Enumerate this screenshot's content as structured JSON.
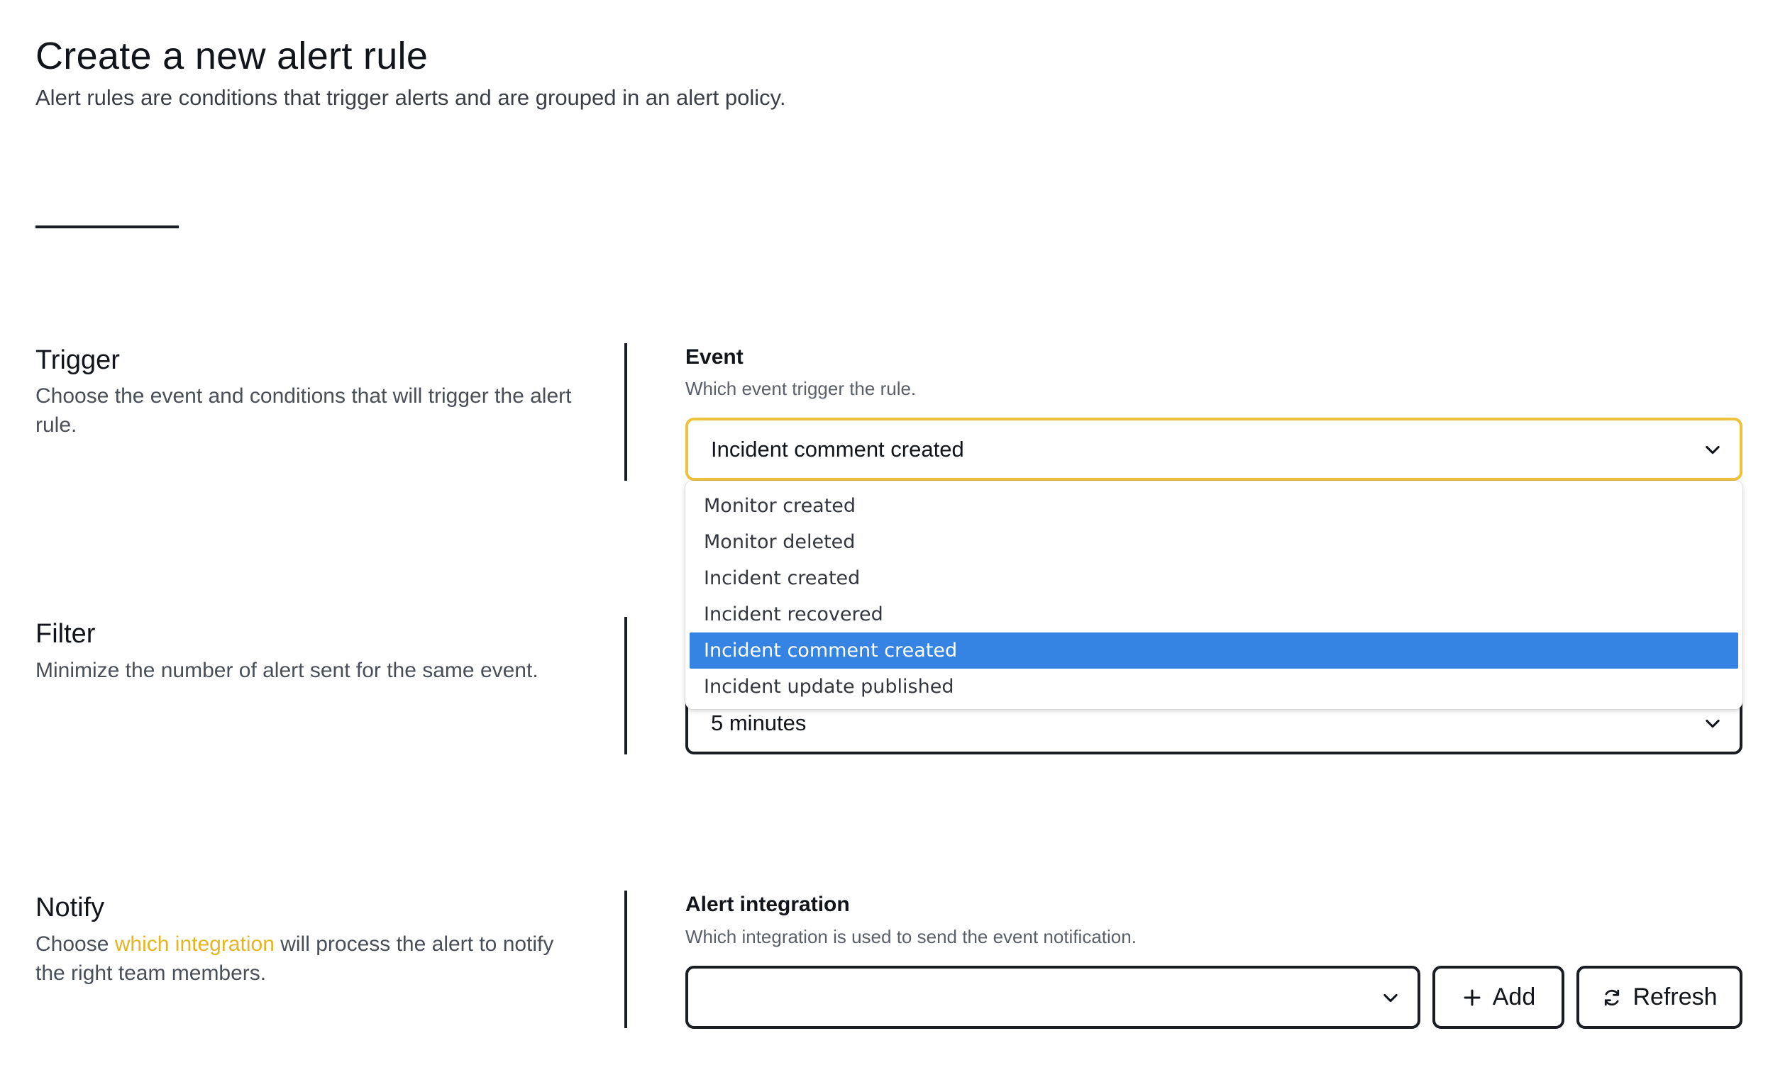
{
  "header": {
    "title": "Create a new alert rule",
    "subtitle": "Alert rules are conditions that trigger alerts and are grouped in an alert policy."
  },
  "trigger": {
    "title": "Trigger",
    "description": "Choose the event and conditions that will trigger the alert rule.",
    "event_label": "Event",
    "event_help": "Which event trigger the rule.",
    "event_value": "Incident comment created",
    "options": [
      "Monitor created",
      "Monitor deleted",
      "Incident created",
      "Incident recovered",
      "Incident comment created",
      "Incident update published"
    ],
    "selected_option": "Incident comment created"
  },
  "filter": {
    "title": "Filter",
    "description": "Minimize the number of alert sent for the same event.",
    "interval_value": "5 minutes"
  },
  "notify": {
    "title": "Notify",
    "description_prefix": "Choose ",
    "description_link": "which integration",
    "description_suffix": " will process the alert to notify the right team members.",
    "integration_label": "Alert integration",
    "integration_help": "Which integration is used to send the event notification.",
    "integration_value": "",
    "add_label": "Add",
    "refresh_label": "Refresh"
  },
  "colors": {
    "accent": "#e6b523",
    "focus_border": "#efc23d",
    "menu_selected": "#3584e4",
    "border": "#1a1d21"
  },
  "icons": {
    "select": "chevron-down-icon",
    "add": "plus-icon",
    "refresh": "refresh-icon"
  }
}
